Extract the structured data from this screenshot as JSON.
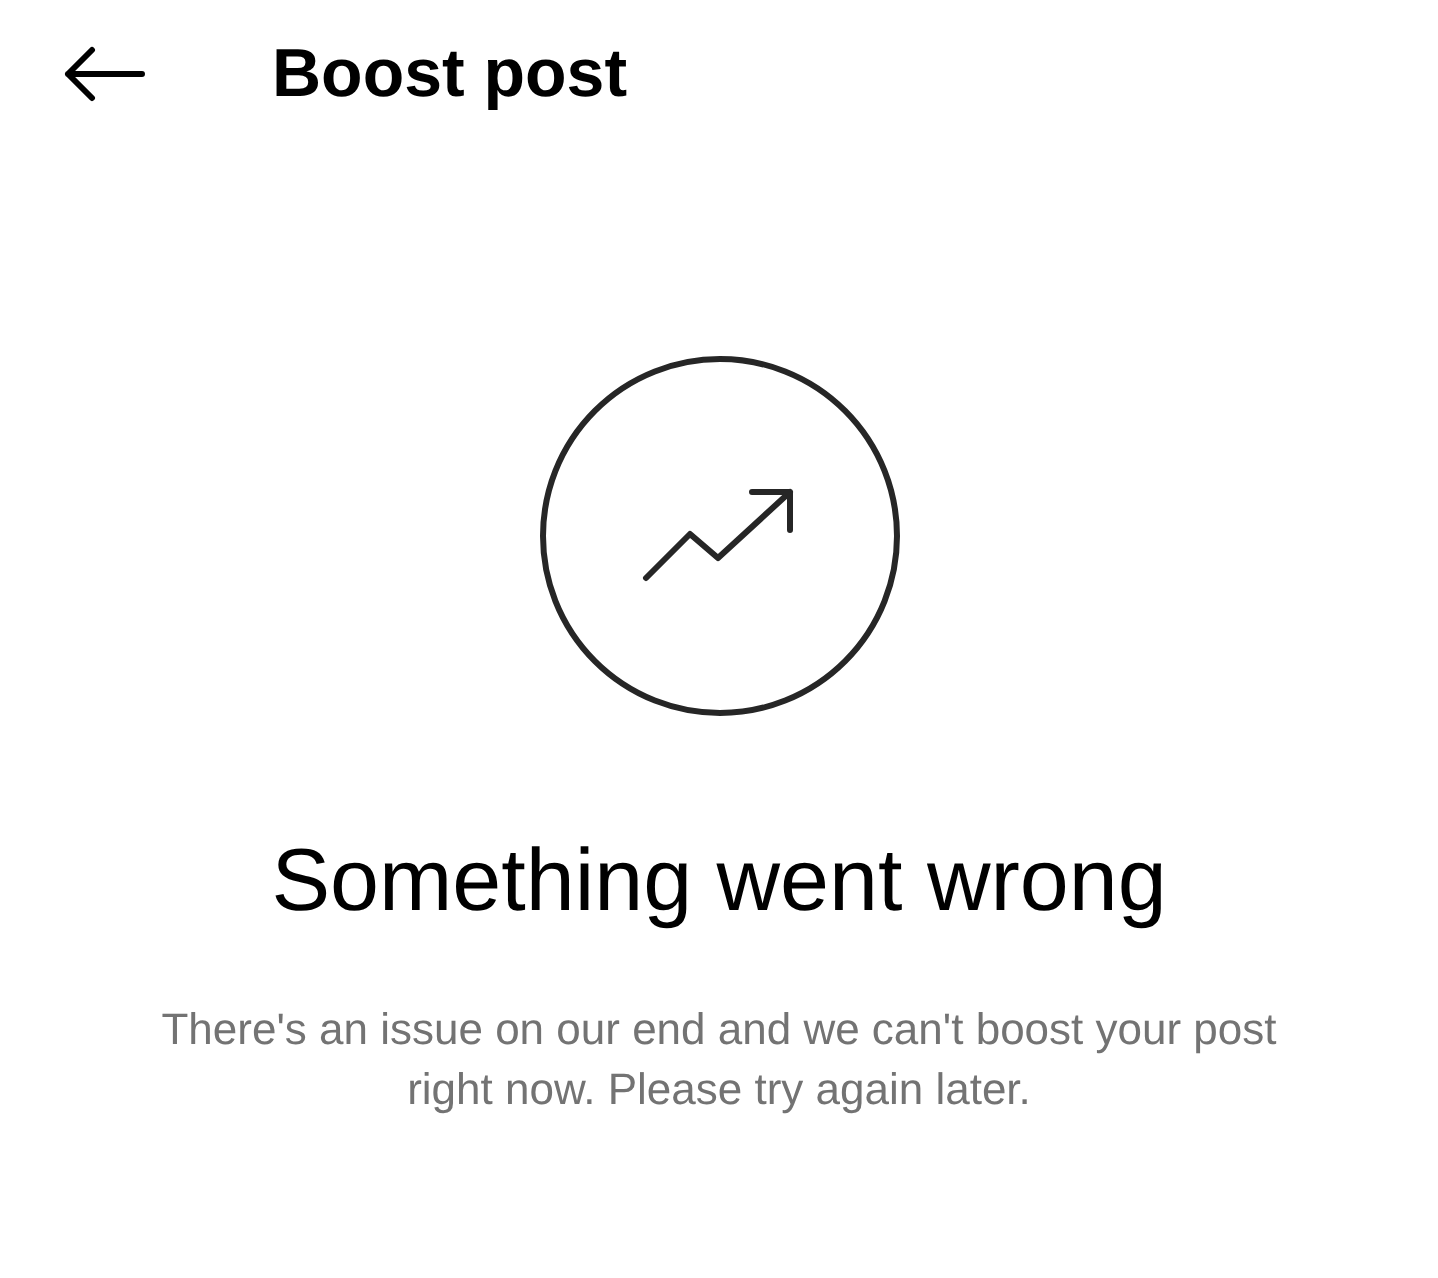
{
  "header": {
    "title": "Boost post"
  },
  "error": {
    "heading": "Something went wrong",
    "message": "There's an issue on our end and we can't boost your post right now. Please try again later."
  }
}
